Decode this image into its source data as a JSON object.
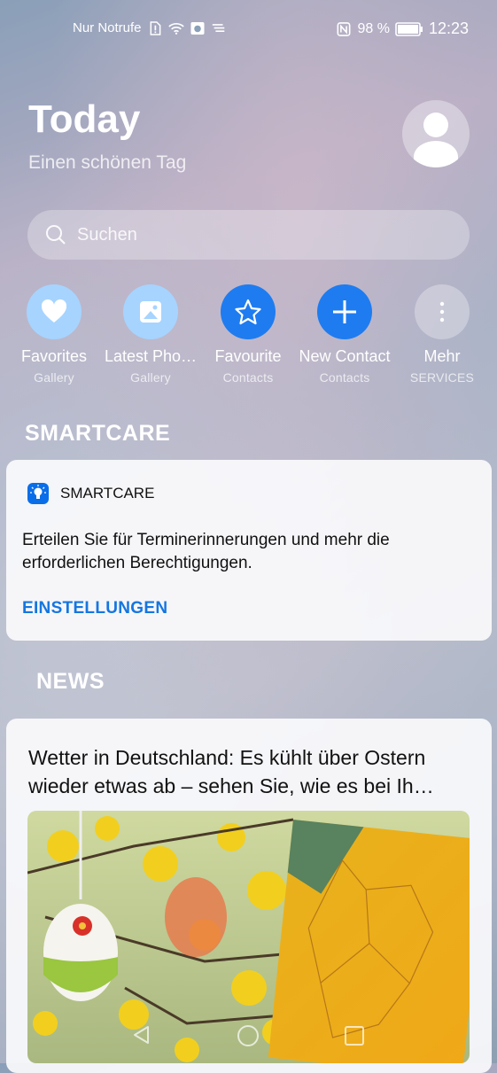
{
  "status": {
    "carrier": "Nur Notrufe",
    "battery_percent": "98 %",
    "time": "12:23",
    "icons": [
      "sim-alert-icon",
      "wifi-icon",
      "sim-card-icon",
      "hotspot-icon",
      "nfc-icon",
      "battery-icon"
    ]
  },
  "header": {
    "title": "Today",
    "subtitle": "Einen schönen Tag",
    "avatar_icon": "user-avatar-icon"
  },
  "search": {
    "placeholder": "Suchen",
    "icon": "search-icon"
  },
  "quick_actions": [
    {
      "label": "Favorites",
      "sub": "Gallery",
      "icon": "heart-icon",
      "color": "#a6d4ff"
    },
    {
      "label": "Latest Pho…",
      "sub": "Gallery",
      "icon": "photo-icon",
      "color": "#a6d4ff"
    },
    {
      "label": "Favourite",
      "sub": "Contacts",
      "icon": "star-icon",
      "color": "#1e7cf0"
    },
    {
      "label": "New Contact",
      "sub": "Contacts",
      "icon": "plus-icon",
      "color": "#1e7cf0"
    },
    {
      "label": "Mehr",
      "sub": "SERVICES",
      "icon": "more-icon",
      "color": "#c9cfdb"
    }
  ],
  "smartcare": {
    "section_title": "SMARTCARE",
    "app_name": "SMARTCARE",
    "message": "Erteilen Sie für Terminerinnerungen und mehr die erforderlichen Berechtigungen.",
    "action": "EINSTELLUNGEN",
    "accent": "#1576e0"
  },
  "news": {
    "section_title": "NEWS",
    "headline": "Wetter in Deutschland: Es kühlt über Ostern wieder etwas ab – sehen Sie, wie es bei Ih…",
    "image_icon": "news-image"
  },
  "navbar": {
    "icons": [
      "back-icon",
      "home-icon",
      "recents-icon"
    ]
  }
}
